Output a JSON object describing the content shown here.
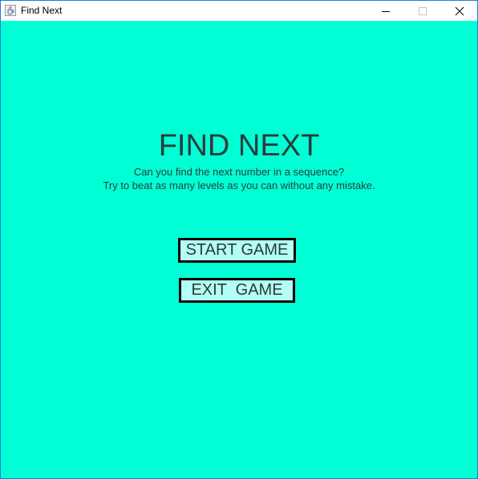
{
  "window": {
    "title": "Find Next",
    "icon": "java-cup-icon",
    "controls": [
      "minimize-icon",
      "maximize-icon",
      "close-icon"
    ]
  },
  "colors": {
    "background": "#00ffd5",
    "text": "#2a3b3a",
    "button_fill": "#b3fff5",
    "button_border": "#000000",
    "window_border": "#1c7fd6"
  },
  "main": {
    "heading": "FIND NEXT",
    "subtitle_line1": "Can you find the next number in a sequence?",
    "subtitle_line2": "Try to beat as many levels as you can without any mistake.",
    "start_button": "START GAME",
    "exit_button": "EXIT  GAME"
  }
}
